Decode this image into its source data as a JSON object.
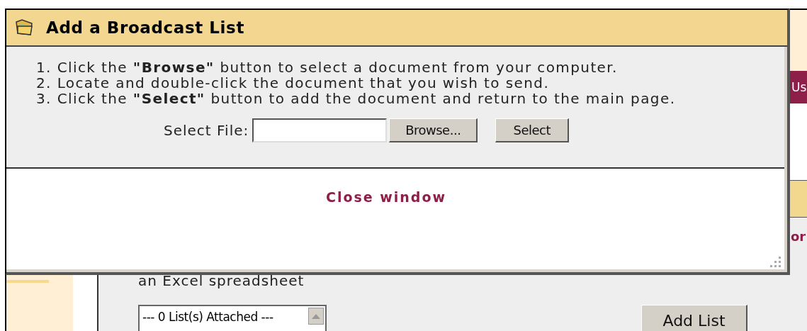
{
  "dialog": {
    "title": "Add a Broadcast List",
    "steps": [
      "1. Click the **\"Browse\"** button to select a document from your computer.",
      "2. Locate and double-click the document that you wish to send.",
      "3. Click the **\"Select\"** button to add the document and return to the main page."
    ],
    "file_label": "Select File:",
    "buttons": [
      "Browse...",
      "Select"
    ],
    "close_link": "Close window"
  },
  "background": {
    "side_tab": "Us",
    "side_text": "or",
    "description": "an Excel spreadsheet",
    "list_box": "--- 0 List(s) Attached ---",
    "add_button": "Add List"
  }
}
